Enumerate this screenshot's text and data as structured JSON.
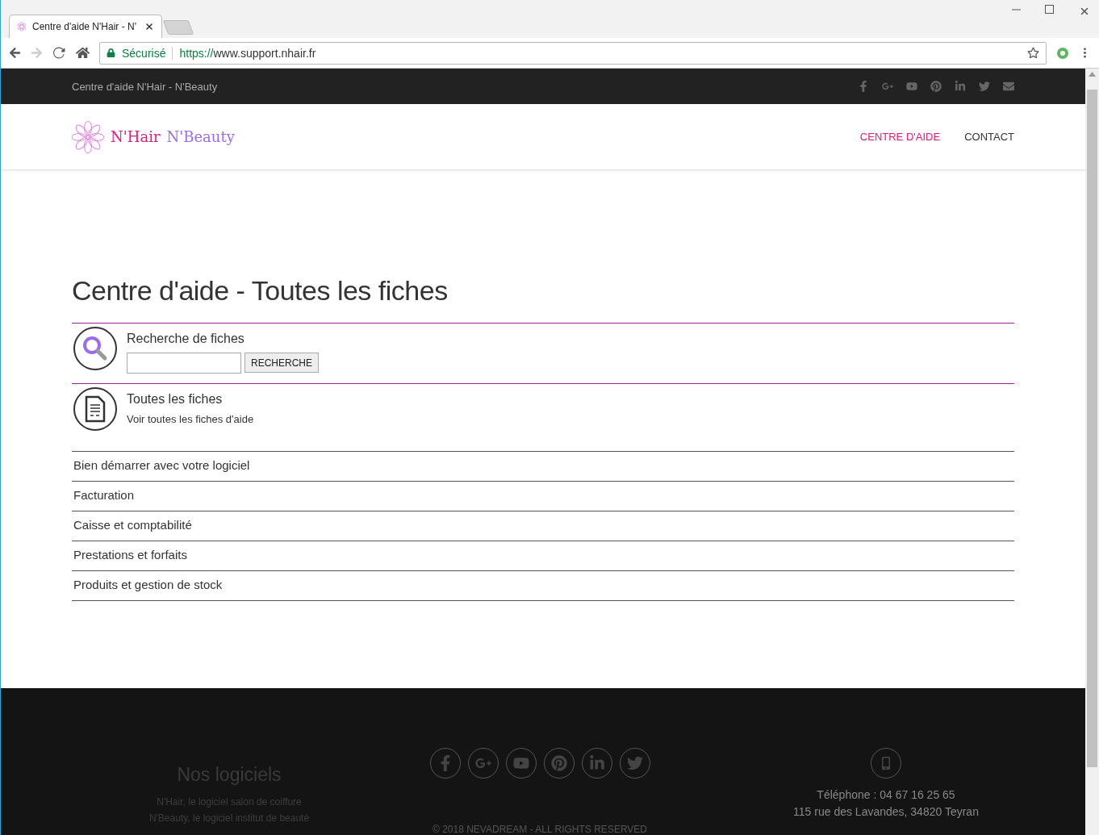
{
  "browser": {
    "tab_title": "Centre d'aide N'Hair - N'",
    "security": "Sécurisé",
    "url_scheme": "https://",
    "url_rest": "www.support.nhair.fr"
  },
  "top_bar": {
    "title": "Centre d'aide N'Hair - N'Beauty"
  },
  "header": {
    "logo_hair": "N'Hair",
    "logo_beauty": "N'Beauty",
    "nav": [
      {
        "label": "CENTRE D'AIDE",
        "selected": true
      },
      {
        "label": "CONTACT",
        "selected": false
      }
    ]
  },
  "heading": "Centre d'aide - Toutes les fiches",
  "search": {
    "title": "Recherche de fiches",
    "button": "RECHERCHE"
  },
  "all_sheets": {
    "title": "Toutes les fiches",
    "subtitle": "Voir toutes les fiches d'aide"
  },
  "categories": [
    "Bien démarrer avec votre logiciel",
    "Facturation",
    "Caisse et comptabilité",
    "Prestations et forfaits",
    "Produits et gestion de stock"
  ],
  "footer": {
    "heading": "Nos logiciels",
    "lines": [
      "N'Hair, le logiciel salon de coiffure",
      "N'Beauty, le logiciel institut de beauté"
    ],
    "phone_label": "Téléphone :",
    "phone": "04 67 16 25 65",
    "address": "115 rue des Lavandes, 34820 Teyran",
    "copyright": "© 2018 NEVADREAM - ALL RIGHTS RESERVED"
  }
}
